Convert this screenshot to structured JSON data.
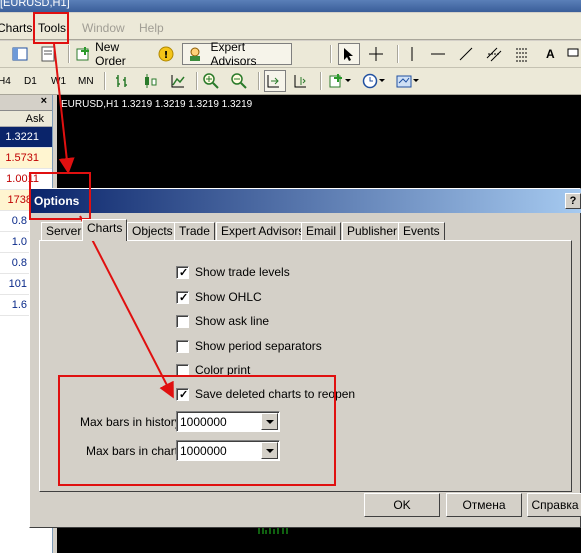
{
  "window": {
    "title": "[EURUSD,H1]"
  },
  "menu": {
    "items": [
      "Charts",
      "Tools",
      "Window",
      "Help"
    ]
  },
  "toolbar": {
    "new_order_label": "New Order",
    "expert_advisors_label": "Expert Advisors",
    "text_tool_label": "A",
    "timeframes": [
      "H4",
      "D1",
      "W1",
      "MN"
    ]
  },
  "market_watch": {
    "ask_header": "Ask",
    "close_glyph": "×",
    "rows": [
      "1.3221",
      "1.5731",
      "1.0011",
      "1738",
      "0.8",
      "1.0",
      "0.8",
      "101",
      "1.6"
    ]
  },
  "chart": {
    "label": "EURUSD,H1  1.3219 1.3219 1.3219 1.3219"
  },
  "dialog": {
    "title": "Options",
    "help_glyph": "?",
    "tabs": [
      "Server",
      "Charts",
      "Objects",
      "Trade",
      "Expert Advisors",
      "Email",
      "Publisher",
      "Events"
    ],
    "active_tab": "Charts",
    "checkboxes": [
      {
        "label": "Show trade levels",
        "checked": true
      },
      {
        "label": "Show OHLC",
        "checked": true
      },
      {
        "label": "Show ask line",
        "checked": false
      },
      {
        "label": "Show period separators",
        "checked": false
      },
      {
        "label": "Color print",
        "checked": false
      },
      {
        "label": "Save deleted charts to reopen",
        "checked": true
      }
    ],
    "max_bars_history": {
      "label": "Max bars in history:",
      "value": "1000000"
    },
    "max_bars_chart": {
      "label": "Max bars in chart:",
      "value": "1000000"
    },
    "buttons": {
      "ok": "OK",
      "cancel": "Отмена",
      "help": "Справка"
    }
  },
  "colors": {
    "annotation": "#e01010",
    "title_bar": "#0a246a",
    "selected_row": "#0a246a"
  }
}
